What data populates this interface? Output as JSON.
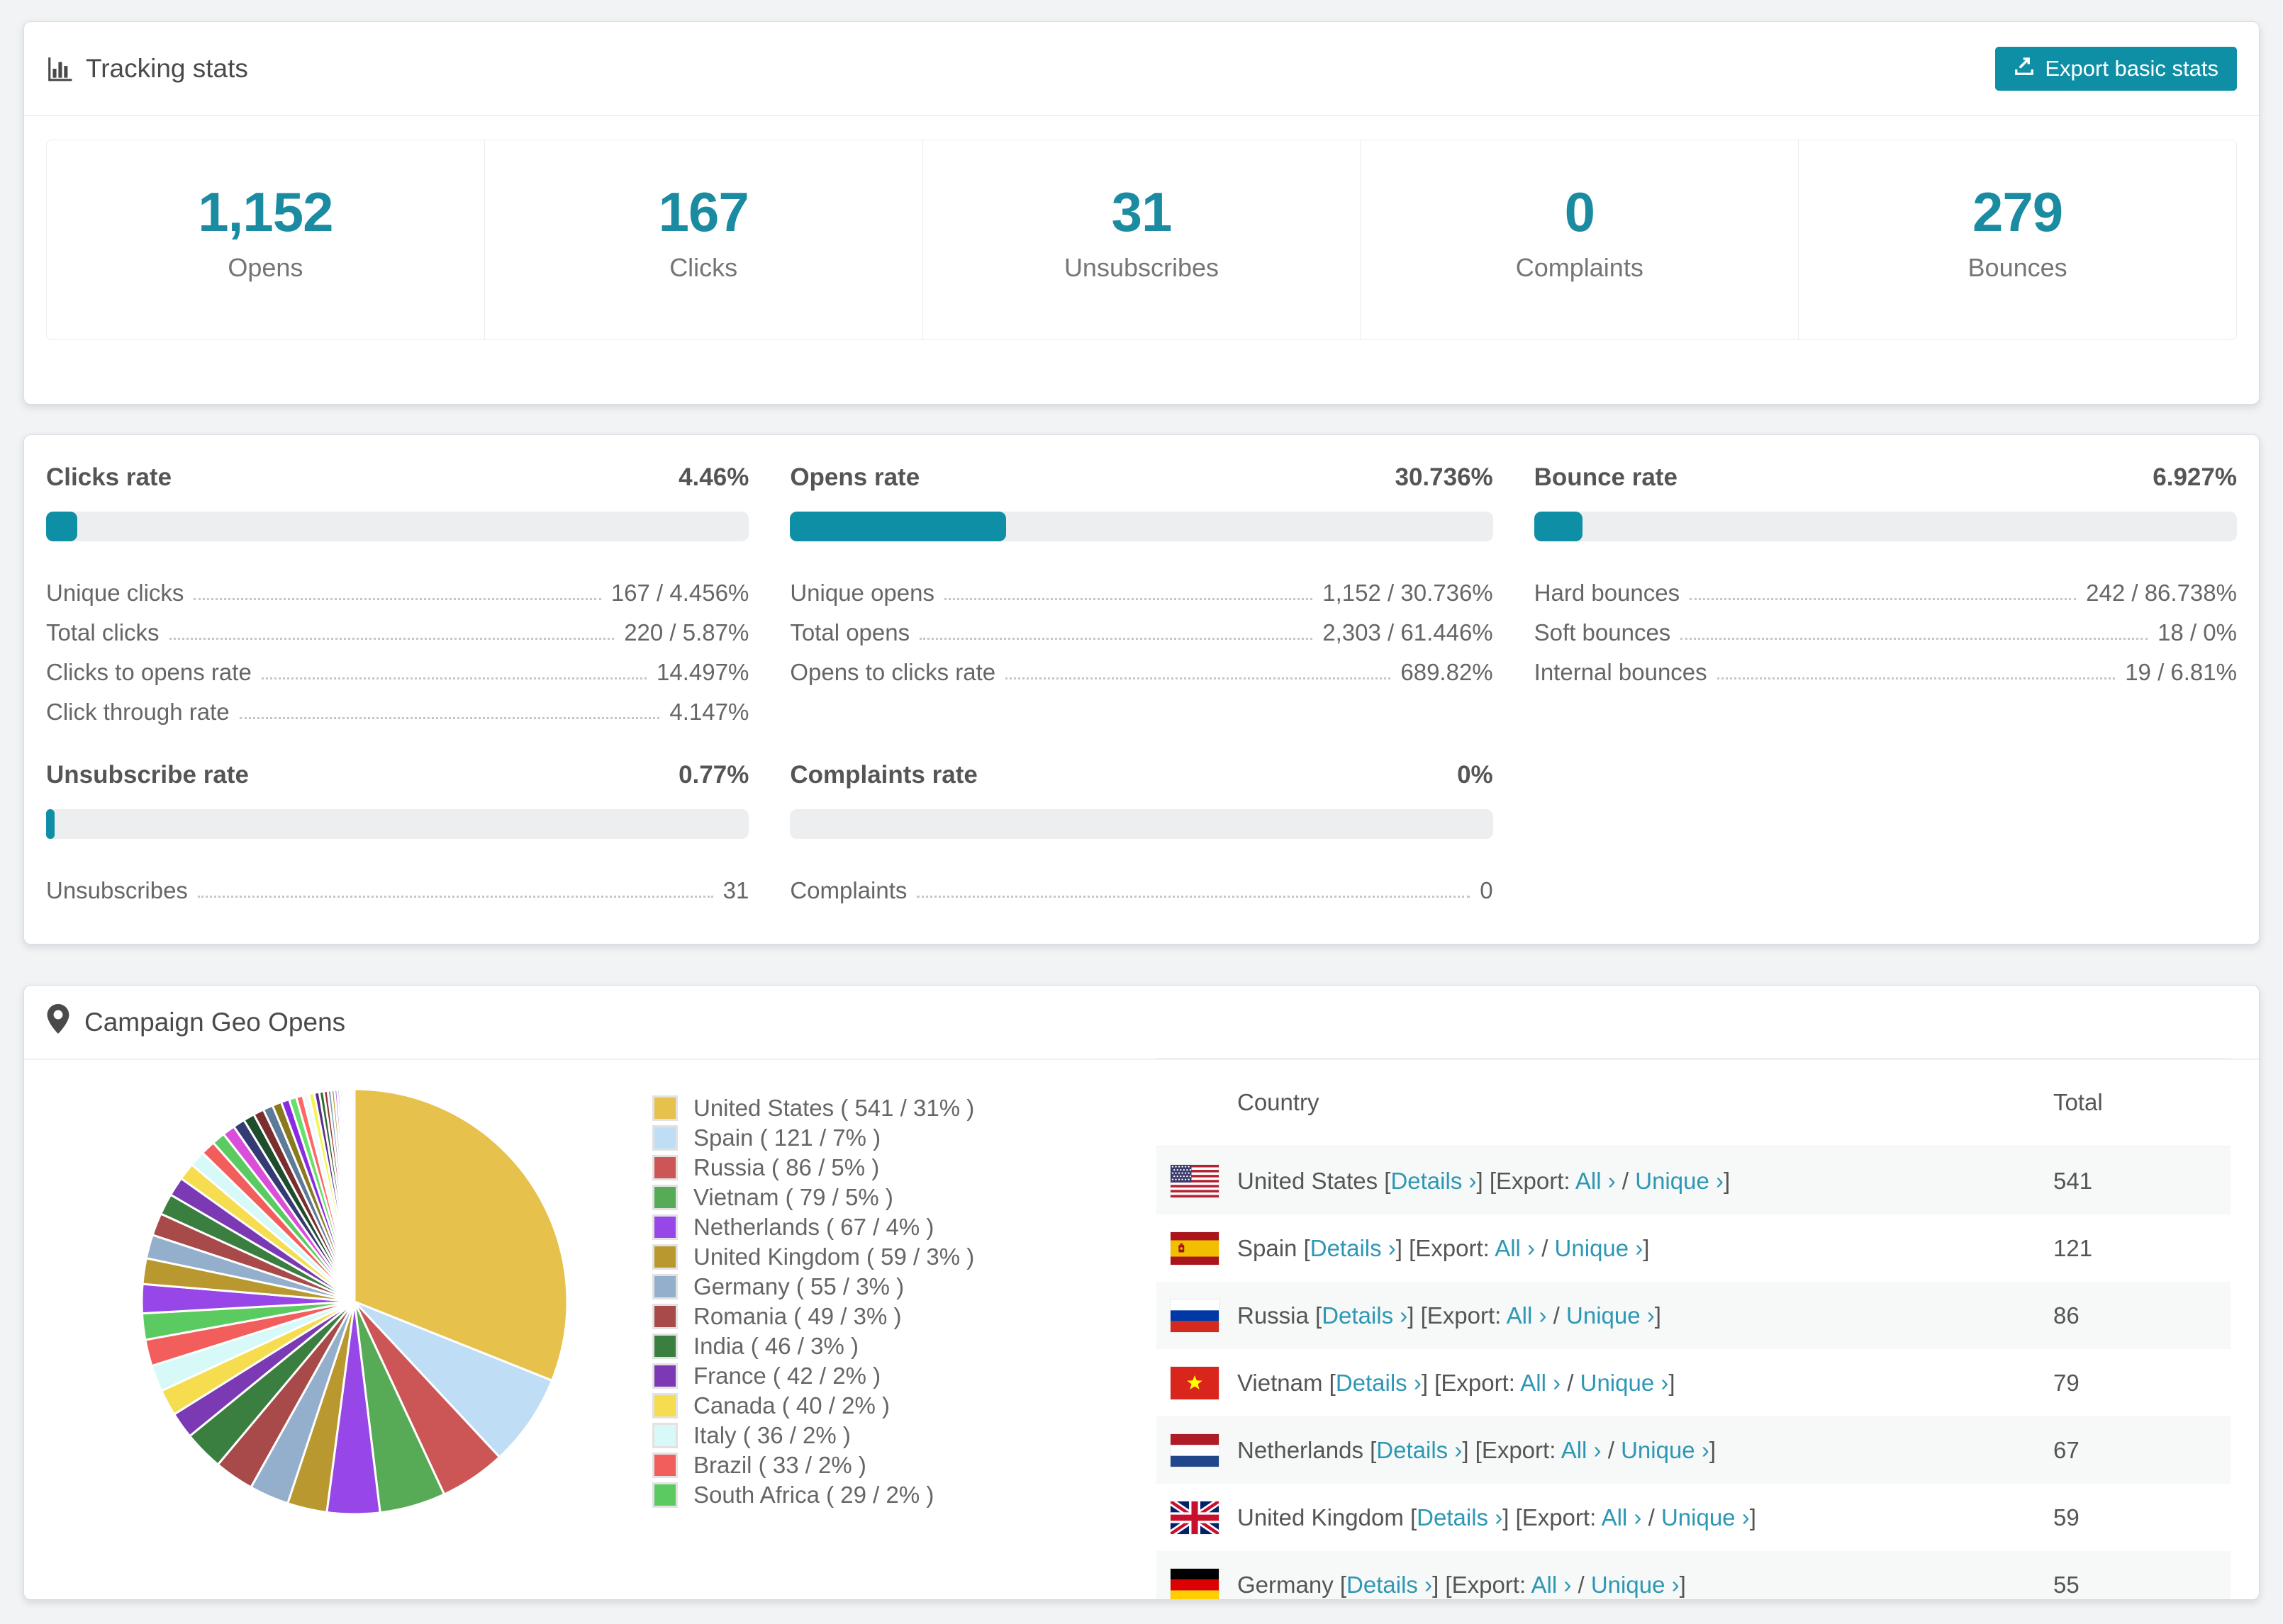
{
  "colors": {
    "accent": "#0f8fa5",
    "link": "#2d97b4",
    "bar_track": "#eceef0",
    "stat_number": "#1a8ba0"
  },
  "tracking": {
    "title": "Tracking stats",
    "export_button": "Export basic stats",
    "stats": [
      {
        "value": "1,152",
        "label": "Opens"
      },
      {
        "value": "167",
        "label": "Clicks"
      },
      {
        "value": "31",
        "label": "Unsubscribes"
      },
      {
        "value": "0",
        "label": "Complaints"
      },
      {
        "value": "279",
        "label": "Bounces"
      }
    ]
  },
  "rates": {
    "blocks": [
      {
        "title": "Clicks rate",
        "value": "4.46%",
        "pct": 4.46,
        "rows": [
          {
            "label": "Unique clicks",
            "value": "167 / 4.456%"
          },
          {
            "label": "Total clicks",
            "value": "220 / 5.87%"
          },
          {
            "label": "Clicks to opens rate",
            "value": "14.497%"
          },
          {
            "label": "Click through rate",
            "value": "4.147%"
          }
        ]
      },
      {
        "title": "Opens rate",
        "value": "30.736%",
        "pct": 30.736,
        "rows": [
          {
            "label": "Unique opens",
            "value": "1,152 / 30.736%"
          },
          {
            "label": "Total opens",
            "value": "2,303 / 61.446%"
          },
          {
            "label": "Opens to clicks rate",
            "value": "689.82%"
          }
        ]
      },
      {
        "title": "Bounce rate",
        "value": "6.927%",
        "pct": 6.927,
        "rows": [
          {
            "label": "Hard bounces",
            "value": "242 / 86.738%"
          },
          {
            "label": "Soft bounces",
            "value": "18 / 0%"
          },
          {
            "label": "Internal bounces",
            "value": "19 / 6.81%"
          }
        ]
      },
      {
        "title": "Unsubscribe rate",
        "value": "0.77%",
        "pct": 0.77,
        "rows": [
          {
            "label": "Unsubscribes",
            "value": "31"
          }
        ]
      },
      {
        "title": "Complaints rate",
        "value": "0%",
        "pct": 0,
        "rows": [
          {
            "label": "Complaints",
            "value": "0"
          }
        ]
      }
    ]
  },
  "geo": {
    "title": "Campaign Geo Opens",
    "links": {
      "ob": "[",
      "details": "Details ›",
      "mid": "] [Export: ",
      "all": "All ›",
      "slash": " / ",
      "unique": "Unique ›",
      "cb": "]"
    },
    "table": {
      "headers": [
        "Country",
        "Total"
      ],
      "rows": [
        {
          "country": "United States",
          "flag": "us",
          "total": "541",
          "alt": true
        },
        {
          "country": "Spain",
          "flag": "es",
          "total": "121",
          "alt": false
        },
        {
          "country": "Russia",
          "flag": "ru",
          "total": "86",
          "alt": true
        },
        {
          "country": "Vietnam",
          "flag": "vn",
          "total": "79",
          "alt": false
        },
        {
          "country": "Netherlands",
          "flag": "nl",
          "total": "67",
          "alt": true
        },
        {
          "country": "United Kingdom",
          "flag": "gb",
          "total": "59",
          "alt": false
        },
        {
          "country": "Germany",
          "flag": "de",
          "total": "55",
          "alt": true
        }
      ]
    }
  },
  "chart_data": {
    "type": "pie",
    "title": "Campaign Geo Opens",
    "start_angle_deg": 0,
    "direction": "clockwise",
    "legend_position": "right",
    "slices": [
      {
        "name": "United States",
        "value": 541,
        "pct": 31,
        "color": "#e6c14b"
      },
      {
        "name": "Spain",
        "value": 121,
        "pct": 7,
        "color": "#bfdef5"
      },
      {
        "name": "Russia",
        "value": 86,
        "pct": 5,
        "color": "#cc5656"
      },
      {
        "name": "Vietnam",
        "value": 79,
        "pct": 5,
        "color": "#57ab57"
      },
      {
        "name": "Netherlands",
        "value": 67,
        "pct": 4,
        "color": "#9747e8"
      },
      {
        "name": "United Kingdom",
        "value": 59,
        "pct": 3,
        "color": "#b9992f"
      },
      {
        "name": "Germany",
        "value": 55,
        "pct": 3,
        "color": "#93afcc"
      },
      {
        "name": "Romania",
        "value": 49,
        "pct": 3,
        "color": "#a84a49"
      },
      {
        "name": "India",
        "value": 46,
        "pct": 3,
        "color": "#3a7f40"
      },
      {
        "name": "France",
        "value": 42,
        "pct": 2,
        "color": "#7b3ab3"
      },
      {
        "name": "Canada",
        "value": 40,
        "pct": 2,
        "color": "#f5dd4f"
      },
      {
        "name": "Italy",
        "value": 36,
        "pct": 2,
        "color": "#d7f9f7"
      },
      {
        "name": "Brazil",
        "value": 33,
        "pct": 2,
        "color": "#f25e5c"
      },
      {
        "name": "South Africa",
        "value": 29,
        "pct": 2,
        "color": "#5bcb61"
      }
    ],
    "others_estimated": {
      "note": "many small unlabeled countries, ~26% combined (values estimated from slice angles)",
      "values": [
        2.2,
        1.95,
        1.8,
        1.7,
        1.6,
        1.45,
        1.3,
        1.2,
        1.1,
        1.0,
        0.95,
        0.9,
        0.85,
        0.8,
        0.75,
        0.7,
        0.62,
        0.56,
        0.5,
        0.46,
        0.42,
        0.38,
        0.34,
        0.3,
        0.27,
        0.24,
        0.21,
        0.19,
        0.17,
        0.15,
        0.13,
        0.11,
        0.1,
        0.09,
        0.08,
        0.07,
        0.06,
        0.05,
        0.05,
        0.04
      ],
      "colors": [
        "#9747e8",
        "#b9992f",
        "#93afcc",
        "#a84a49",
        "#3a7f40",
        "#7b3ab3",
        "#f5dd4f",
        "#d7f9f7",
        "#f25e5c",
        "#5bcb61",
        "#d94fd9",
        "#343a73",
        "#1e4d2b",
        "#7a2e2e",
        "#5c7a99",
        "#8a7a1e",
        "#8a2be2",
        "#66e06a",
        "#ff6666",
        "#eefcff",
        "#f5f54f",
        "#5a2d8a",
        "#2e6b34",
        "#993333",
        "#7f99b2",
        "#b0a030",
        "#c455f0",
        "#55dd88",
        "#ee5555",
        "#ccf5ff",
        "#f0e555",
        "#4a2a7a",
        "#254d2a",
        "#882222",
        "#6688aa",
        "#998822",
        "#aa44cc",
        "#44bb55",
        "#dd4444",
        "#aaddff"
      ]
    }
  }
}
